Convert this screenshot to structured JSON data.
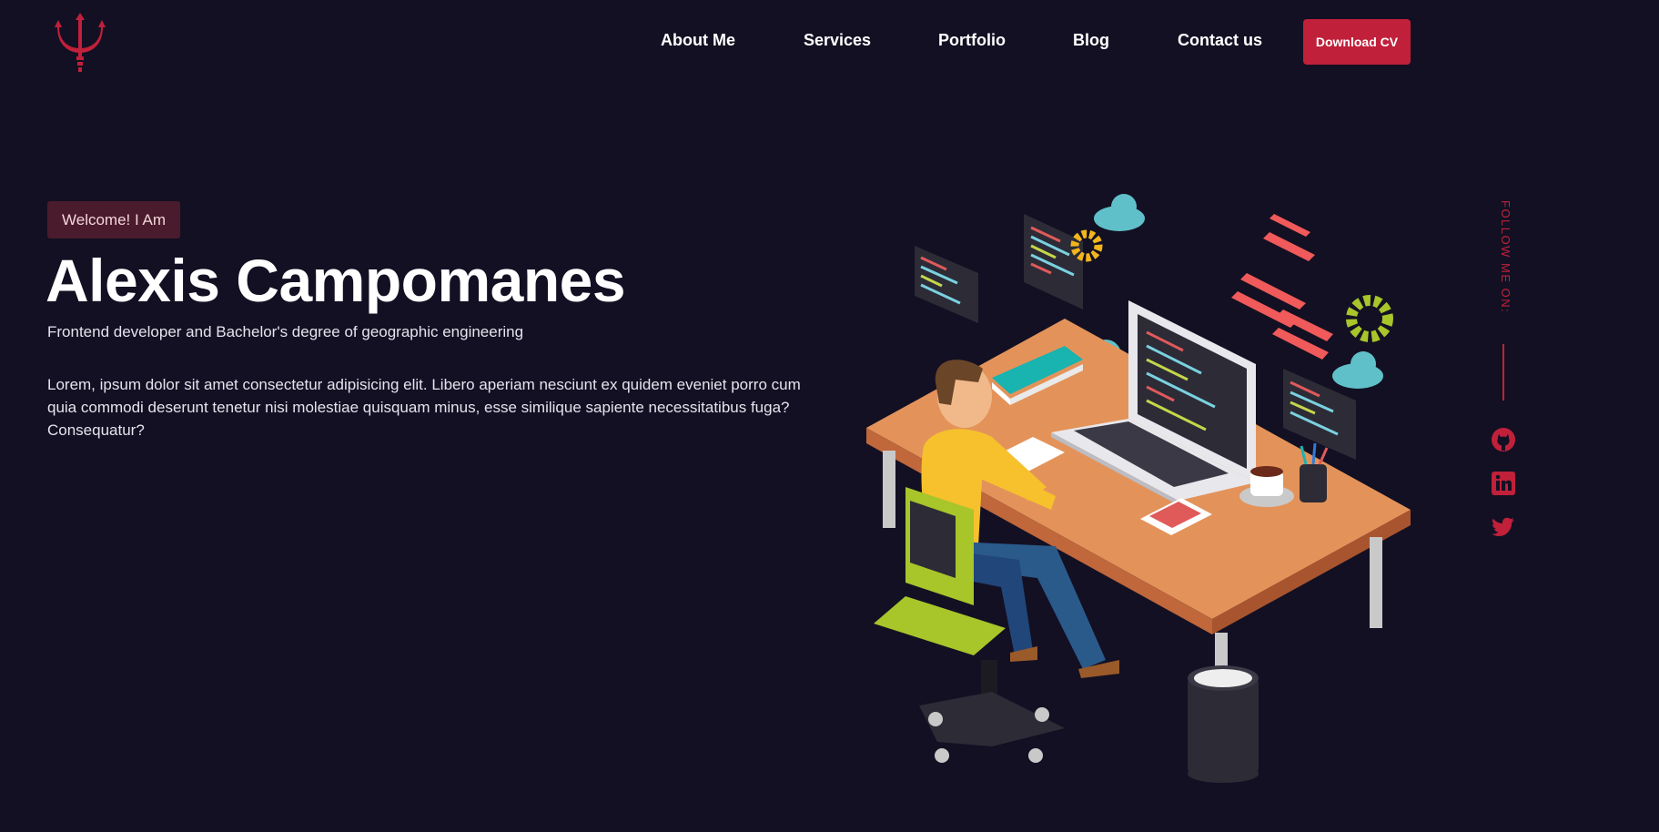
{
  "header": {
    "logo_icon": "trident-icon",
    "nav": {
      "about": "About Me",
      "services": "Services",
      "portfolio": "Portfolio",
      "blog": "Blog",
      "contact": "Contact us"
    },
    "cv_button": "Download CV"
  },
  "hero": {
    "badge": "Welcome! I Am",
    "name": "Alexis Campomanes",
    "subtitle": "Frontend developer and Bachelor's degree of geographic engineering",
    "description": "Lorem, ipsum dolor sit amet consectetur adipisicing elit. Libero aperiam nesciunt ex quidem eveniet porro cum quia commodi deserunt tenetur nisi molestiae quisquam minus, esse similique sapiente necessitatibus fuga? Consequatur?",
    "illustration": "developer-at-desk-illustration"
  },
  "follow": {
    "label": "FOLLOW ME ON:",
    "icons": [
      "github-icon",
      "linkedin-icon",
      "twitter-icon"
    ]
  },
  "colors": {
    "background": "#131023",
    "accent": "#c1203a",
    "badge_bg": "#4a1b2c"
  }
}
